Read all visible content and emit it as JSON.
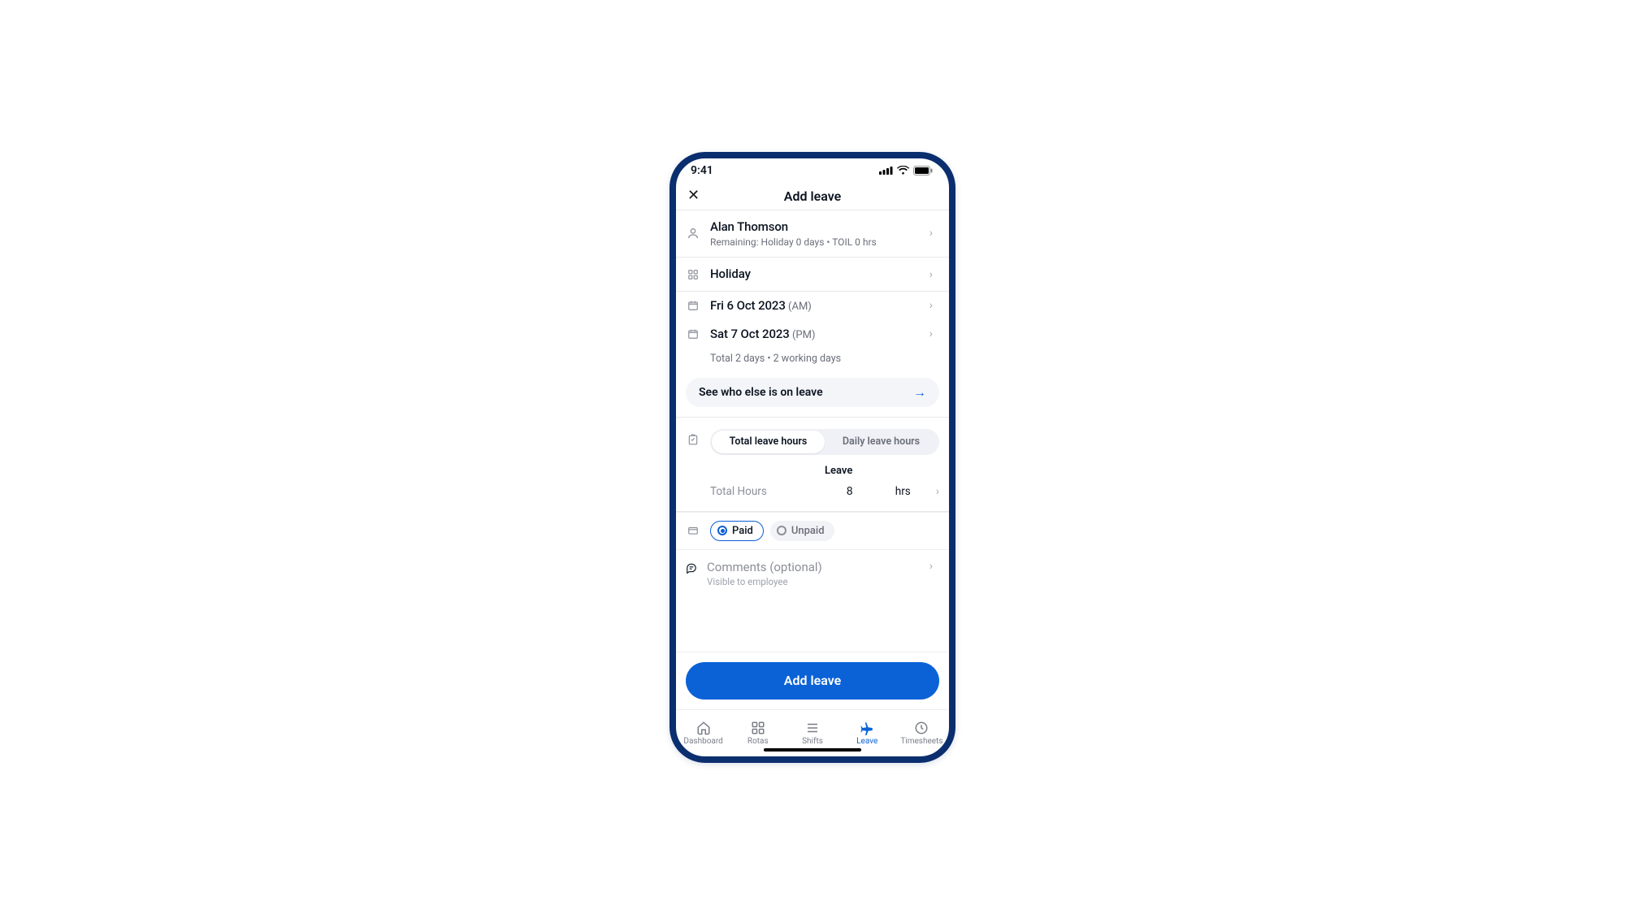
{
  "status": {
    "time": "9:41"
  },
  "header": {
    "title": "Add leave"
  },
  "employee": {
    "name": "Alan Thomson",
    "remaining": "Remaining: Holiday 0 days • TOIL 0 hrs"
  },
  "leave_type": {
    "label": "Holiday"
  },
  "dates": {
    "from_date": "Fri 6 Oct 2023",
    "from_annot": "(AM)",
    "to_date": "Sat 7 Oct 2023",
    "to_annot": "(PM)",
    "totals": "Total 2 days  •  2 working days"
  },
  "see_who": {
    "label": "See who else is on leave"
  },
  "hours": {
    "seg_total": "Total leave hours",
    "seg_daily": "Daily leave hours",
    "column_head": "Leave",
    "row_label": "Total Hours",
    "value": "8",
    "unit": "hrs"
  },
  "pay": {
    "paid": "Paid",
    "unpaid": "Unpaid"
  },
  "comments": {
    "title": "Comments (optional)",
    "sub": "Visible to employee"
  },
  "cta": {
    "label": "Add leave"
  },
  "tabs": {
    "dashboard": "Dashboard",
    "rotas": "Rotas",
    "shifts": "Shifts",
    "leave": "Leave",
    "timesheets": "Timesheets"
  }
}
